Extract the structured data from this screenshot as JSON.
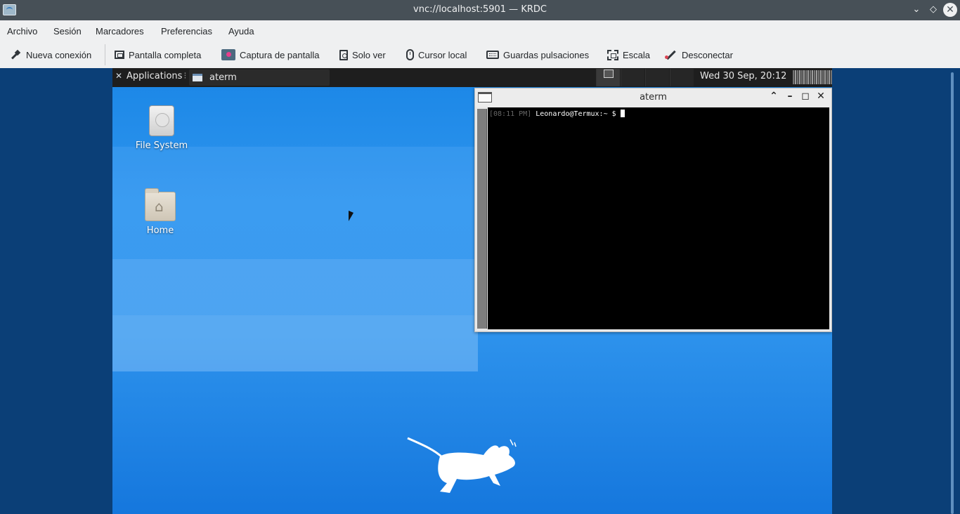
{
  "window": {
    "title": "vnc://localhost:5901 — KRDC",
    "app_icon": "krdc-icon",
    "controls": [
      "chevron-down-icon",
      "diamond-icon",
      "close-icon"
    ]
  },
  "menubar": {
    "items": [
      "Archivo",
      "Sesión",
      "Marcadores",
      "Preferencias",
      "Ayuda"
    ]
  },
  "toolbar": {
    "items": [
      {
        "label": "Nueva conexión",
        "icon": "plug-icon"
      },
      {
        "label": "Pantalla completa",
        "icon": "fullscreen-icon"
      },
      {
        "label": "Captura de pantalla",
        "icon": "screenshot-icon"
      },
      {
        "label": "Solo ver",
        "icon": "view-only-icon"
      },
      {
        "label": "Cursor local",
        "icon": "mouse-icon"
      },
      {
        "label": "Guardas pulsaciones",
        "icon": "keyboard-icon"
      },
      {
        "label": "Escala",
        "icon": "scale-icon"
      },
      {
        "label": "Desconectar",
        "icon": "disconnect-icon"
      }
    ]
  },
  "remote": {
    "panel": {
      "applications_label": "Applications",
      "task_label": "aterm",
      "clock": "Wed 30 Sep, 20:12"
    },
    "desktop_icons": [
      {
        "label": "File System",
        "icon": "drive-icon"
      },
      {
        "label": "Home",
        "icon": "home-folder-icon"
      }
    ],
    "terminal": {
      "title": "aterm",
      "timestamp": "[08:11 PM]",
      "prompt": " Leonardo@Termux:~ $ "
    }
  },
  "colors": {
    "titlebar": "#475057",
    "chrome": "#eff0f1",
    "desktop_blue": "#1a86e6",
    "panel": "#1e1e1e",
    "terminal_bg": "#000000"
  }
}
